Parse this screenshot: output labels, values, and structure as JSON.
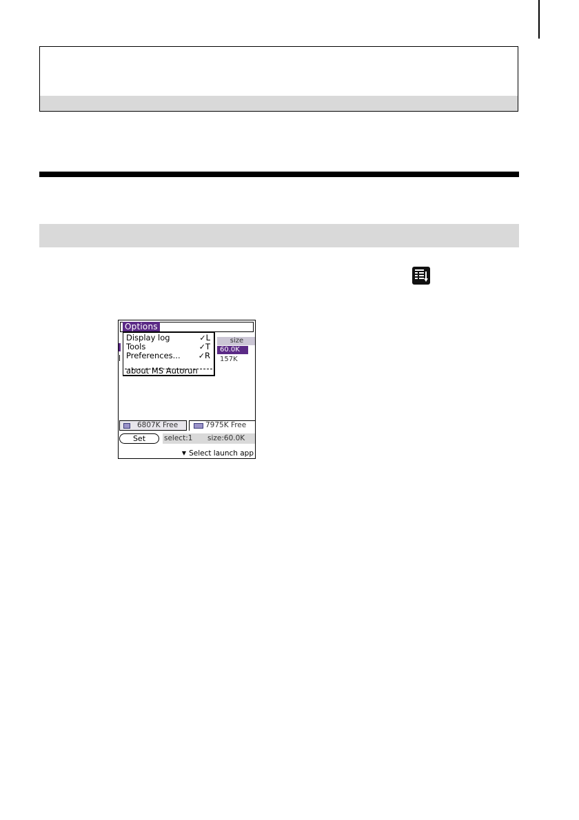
{
  "icons": {
    "menu": "menu-icon"
  },
  "colors": {
    "menu_highlight": "#5b2a86",
    "header_band": "#d9d9d9"
  },
  "screen": {
    "menu_title": "Options",
    "menu_items": [
      {
        "label": "Display log",
        "shortcut": "L"
      },
      {
        "label": "Tools",
        "shortcut": "T"
      },
      {
        "label": "Preferences...",
        "shortcut": "R"
      },
      {
        "label": "about MS Autorun",
        "shortcut": ""
      }
    ],
    "list_header": "size",
    "list_rows": [
      "60.0K",
      "157K"
    ],
    "free_left": "6807K Free",
    "free_right": "7975K Free",
    "set_button": "Set",
    "status_select": "select:1",
    "status_size": "size:60.0K",
    "launch_label": "Select launch app"
  }
}
